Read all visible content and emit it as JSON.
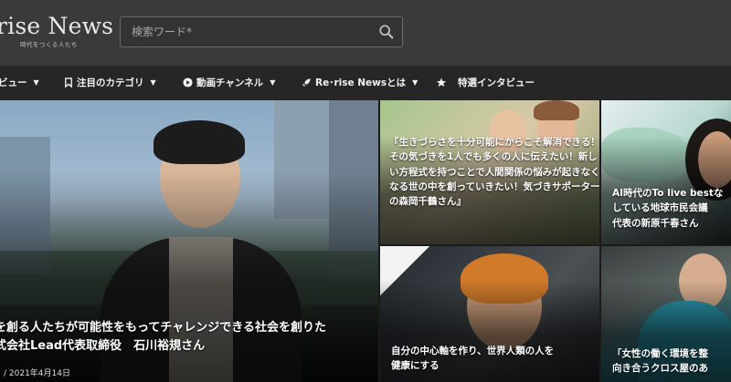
{
  "header": {
    "logo_title": "rise News",
    "logo_tagline": "時代をつくる人たち",
    "search_placeholder": "検索ワード*",
    "search_icon": "search-icon"
  },
  "nav": {
    "items": [
      {
        "label": "ビュー",
        "icon": "none",
        "caret": "▼"
      },
      {
        "label": "注目のカテゴリ",
        "icon": "bookmark-icon",
        "caret": "▼"
      },
      {
        "label": "動画チャンネル",
        "icon": "play-circle-icon",
        "caret": "▼"
      },
      {
        "label": "Re･rise Newsとは",
        "icon": "rocket-icon",
        "caret": "▼"
      },
      {
        "label": "特選インタビュー",
        "icon": "star-icon",
        "caret": ""
      }
    ]
  },
  "articles": {
    "hero": {
      "title_line1": "を創る人たちが可能性をもってチャレンジできる社会を創りた",
      "title_line2": "式会社Lead代表取締役　石川裕規さん",
      "date": "/ 2021年4月14日"
    },
    "a": {
      "title": "『生きづらさを十分可能にからこそ解消できる！その気づきを1人でも多くの人に伝えたい！新しい方程式を持つことで人間関係の悩みが起きなくなる世の中を創っていきたい！気づきサポーターの森岡千鶴さん』"
    },
    "b": {
      "title_line1": "AI時代のTo live bestな",
      "title_line2": "している地球市民会議",
      "title_line3": "代表の新原千春さん"
    },
    "c": {
      "title_line1": "自分の中心軸を作り、世界人類の人を",
      "title_line2": "健康にする"
    },
    "d": {
      "title_line1": "「女性の働く環境を整",
      "title_line2": "向き合うクロス屋のあ"
    }
  },
  "colors": {
    "header_bg": "#3a3a3a",
    "nav_bg": "#262626",
    "text": "#ffffff"
  }
}
